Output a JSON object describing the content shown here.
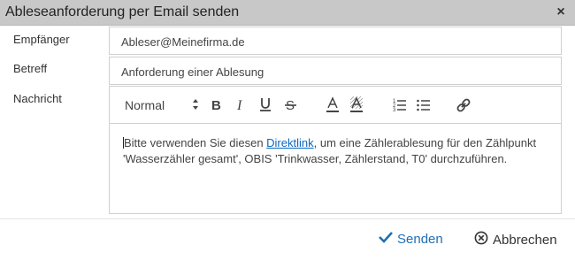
{
  "dialog": {
    "title": "Ableseanforderung per Email senden",
    "close_icon": "close-icon"
  },
  "form": {
    "recipient_label": "Empfänger",
    "recipient_value": "Ableser@Meinefirma.de",
    "subject_label": "Betreff",
    "subject_value": "Anforderung einer Ablesung",
    "message_label": "Nachricht"
  },
  "editor": {
    "toolbar": {
      "font_size": "Normal",
      "buttons": [
        "bold-icon",
        "italic-icon",
        "underline-icon",
        "strikethrough-icon",
        "text-color-icon",
        "background-color-icon",
        "ordered-list-icon",
        "bullet-list-icon",
        "link-icon"
      ]
    },
    "body": {
      "text_before_link": "Bitte verwenden Sie diesen ",
      "link_text": "Direktlink",
      "text_after_link": ", um eine Zählerablesung für den Zählpunkt",
      "line2": "'Wasserzähler gesamt', OBIS 'Trinkwasser, Zählerstand, T0' durchzuführen."
    }
  },
  "footer": {
    "send_label": "Senden",
    "cancel_label": "Abbrechen"
  },
  "colors": {
    "accent": "#1f6fb5",
    "link": "#0b67c2",
    "titlebar": "#c8c8c8"
  }
}
